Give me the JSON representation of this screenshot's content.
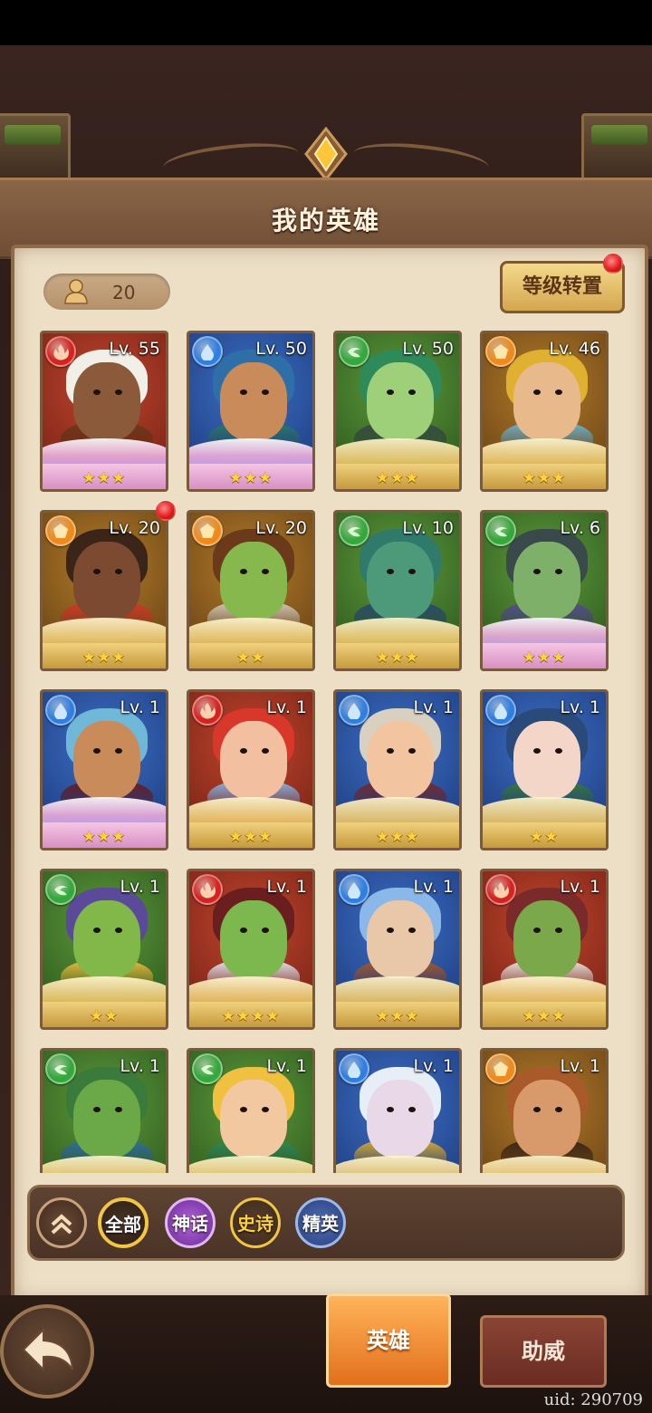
{
  "header": {
    "title": "我的英雄"
  },
  "hero_count": {
    "icon": "person-icon",
    "value": "20"
  },
  "transfer_button": {
    "label": "等级转置",
    "has_notification": true
  },
  "heroes": [
    {
      "level": "Lv. 55",
      "element": "fire",
      "stars": "★★★",
      "frame": "pink"
    },
    {
      "level": "Lv. 50",
      "element": "water",
      "stars": "★★★",
      "frame": "pink"
    },
    {
      "level": "Lv. 50",
      "element": "wind",
      "stars": "★★★",
      "frame": "gold"
    },
    {
      "level": "Lv. 46",
      "element": "earth",
      "stars": "★★★",
      "frame": "gold"
    },
    {
      "level": "Lv. 20",
      "element": "earth",
      "stars": "★★★",
      "frame": "gold",
      "has_notification": true
    },
    {
      "level": "Lv. 20",
      "element": "earth",
      "stars": "★★",
      "frame": "gold"
    },
    {
      "level": "Lv. 10",
      "element": "wind",
      "stars": "★★★",
      "frame": "gold"
    },
    {
      "level": "Lv. 6",
      "element": "wind",
      "stars": "★★★",
      "frame": "pink"
    },
    {
      "level": "Lv. 1",
      "element": "water",
      "stars": "★★★",
      "frame": "pink"
    },
    {
      "level": "Lv. 1",
      "element": "fire",
      "stars": "★★★",
      "frame": "gold"
    },
    {
      "level": "Lv. 1",
      "element": "water",
      "stars": "★★★",
      "frame": "gold"
    },
    {
      "level": "Lv. 1",
      "element": "water",
      "stars": "★★",
      "frame": "gold"
    },
    {
      "level": "Lv. 1",
      "element": "wind",
      "stars": "★★",
      "frame": "gold"
    },
    {
      "level": "Lv. 1",
      "element": "fire",
      "stars": "★★★★",
      "frame": "gold"
    },
    {
      "level": "Lv. 1",
      "element": "water",
      "stars": "★★★",
      "frame": "gold"
    },
    {
      "level": "Lv. 1",
      "element": "fire",
      "stars": "★★★",
      "frame": "gold"
    },
    {
      "level": "Lv. 1",
      "element": "wind",
      "stars": "",
      "frame": "gold"
    },
    {
      "level": "Lv. 1",
      "element": "wind",
      "stars": "",
      "frame": "gold"
    },
    {
      "level": "Lv. 1",
      "element": "water",
      "stars": "",
      "frame": "gold"
    },
    {
      "level": "Lv. 1",
      "element": "earth",
      "stars": "",
      "frame": "gold"
    }
  ],
  "filters": {
    "collapse_icon": "double-chevron-up-icon",
    "all": "全部",
    "mythic": "神话",
    "epic": "史诗",
    "elite": "精英"
  },
  "bottom_nav": {
    "back_icon": "back-arrow-icon",
    "heroes_tab": "英雄",
    "assist_tab": "助威"
  },
  "uid": "uid: 290709",
  "colors": {
    "fire": "#d4231f",
    "water": "#2f7fe0",
    "wind": "#35a83c",
    "earth": "#ef8a1a",
    "accent_orange": "#e26f1c"
  }
}
